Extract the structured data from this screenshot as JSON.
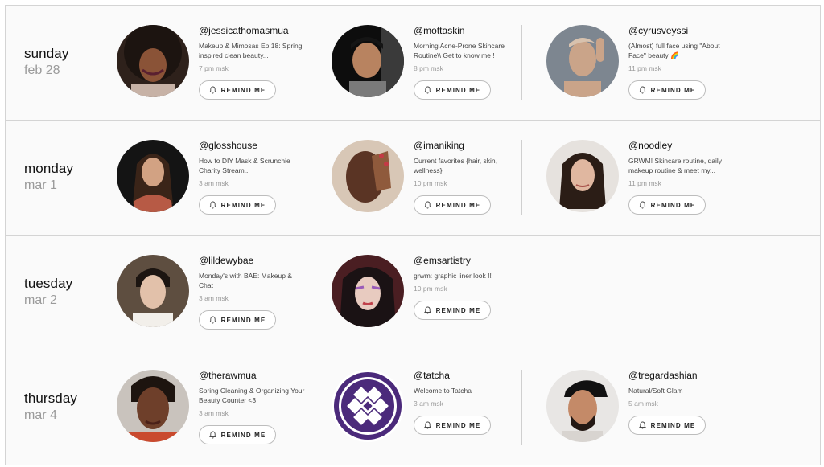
{
  "remind_label": "REMIND ME",
  "days": [
    {
      "name": "sunday",
      "date": "feb 28",
      "events": [
        {
          "handle": "@jessicathomasmua",
          "desc": "Makeup & Mimosas Ep 18: Spring inspired clean beauty...",
          "time": "7 pm msk",
          "avatar": "woman-curly-hair"
        },
        {
          "handle": "@mottaskin",
          "desc": "Morning Acne-Prone Skincare Routine\\\\ Get to know me !",
          "time": "8 pm msk",
          "avatar": "man-dark-background"
        },
        {
          "handle": "@cyrusveyssi",
          "desc": "(Almost) full face using \"About Face\" beauty 🌈",
          "time": "11 pm msk",
          "avatar": "man-grey-background"
        }
      ]
    },
    {
      "name": "monday",
      "date": "mar 1",
      "events": [
        {
          "handle": "@glosshouse",
          "desc": "How to DIY Mask & Scrunchie Charity Stream...",
          "time": "3 am msk",
          "avatar": "woman-dark-background"
        },
        {
          "handle": "@imaniking",
          "desc": "Current favorites {hair, skin, wellness}",
          "time": "10 pm msk",
          "avatar": "woman-hand-on-face"
        },
        {
          "handle": "@noodley",
          "desc": "GRWM! Skincare routine, daily makeup routine & meet my...",
          "time": "11 pm msk",
          "avatar": "woman-curly-dark-hair"
        }
      ]
    },
    {
      "name": "tuesday",
      "date": "mar 2",
      "events": [
        {
          "handle": "@lildewybae",
          "desc": "Monday's with BAE: Makeup & Chat",
          "time": "3 am msk",
          "avatar": "woman-hair-pulled-back"
        },
        {
          "handle": "@emsartistry",
          "desc": "grwm: graphic liner look !!",
          "time": "10 pm msk",
          "avatar": "woman-purple-eyeshadow"
        }
      ]
    },
    {
      "name": "thursday",
      "date": "mar 4",
      "events": [
        {
          "handle": "@therawmua",
          "desc": "Spring Cleaning & Organizing Your Beauty Counter <3",
          "time": "3 am msk",
          "avatar": "woman-closeup"
        },
        {
          "handle": "@tatcha",
          "desc": "Welcome to Tatcha",
          "time": "3 am msk",
          "avatar": "tatcha-logo"
        },
        {
          "handle": "@tregardashian",
          "desc": "Natural/Soft Glam",
          "time": "5 am msk",
          "avatar": "man-with-cap"
        }
      ]
    }
  ],
  "colors": {
    "row_background": "#fafafa",
    "border": "#d4d4d4",
    "muted_text": "#9a9a9a",
    "tatcha_purple": "#4b2a7b"
  }
}
